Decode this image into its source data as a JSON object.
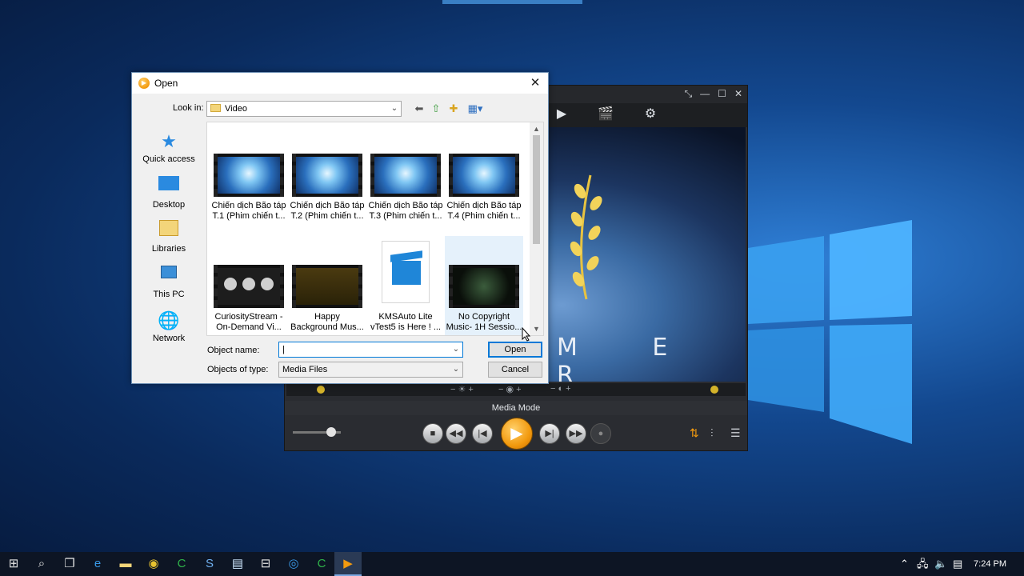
{
  "dialog": {
    "title": "Open",
    "look_in_label": "Look in:",
    "look_in_value": "Video",
    "places": [
      {
        "label": "Quick access",
        "icon": "star-icon"
      },
      {
        "label": "Desktop",
        "icon": "desktop-icon"
      },
      {
        "label": "Libraries",
        "icon": "libraries-icon"
      },
      {
        "label": "This PC",
        "icon": "computer-icon"
      },
      {
        "label": "Network",
        "icon": "network-icon"
      }
    ],
    "files": [
      {
        "line1": "Chiến dịch Bão táp",
        "line2": "T.1 (Phim chiến t..."
      },
      {
        "line1": "Chiến dịch Bão táp",
        "line2": "T.2 (Phim chiến t..."
      },
      {
        "line1": "Chiến dịch Bão táp",
        "line2": "T.3 (Phim chiến t..."
      },
      {
        "line1": "Chiến dịch Bão táp",
        "line2": "T.4 (Phim chiến t..."
      },
      {
        "line1": "CuriosityStream -",
        "line2": "On-Demand Vi..."
      },
      {
        "line1": "Happy",
        "line2": "Background Mus..."
      },
      {
        "line1": "KMSAuto Lite",
        "line2": "vTest5 is Here ! ..."
      },
      {
        "line1": "No Copyright",
        "line2": "Music- 1H Sessio..."
      }
    ],
    "object_name_label": "Object name:",
    "object_name_value": "",
    "objects_type_label": "Objects of type:",
    "objects_type_value": "Media Files",
    "open_button": "Open",
    "cancel_button": "Cancel"
  },
  "player": {
    "mode_label": "Media Mode",
    "screen_text": "M E R",
    "accent": "#f29a0f"
  },
  "taskbar": {
    "time": "7:24 PM"
  }
}
